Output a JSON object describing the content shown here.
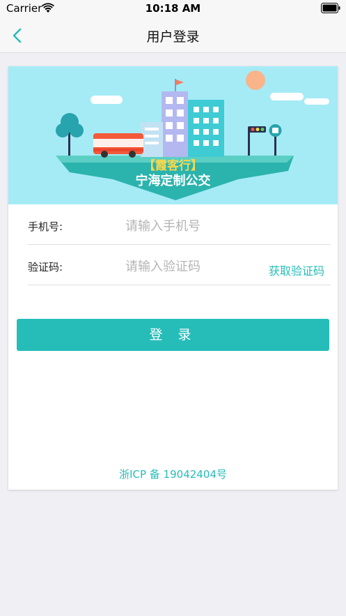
{
  "status_bar": {
    "carrier": "Carrier",
    "time": "10:18 AM"
  },
  "nav": {
    "title": "用户登录",
    "back_icon": "chevron-left-icon"
  },
  "banner": {
    "brand_name": "【霞客行】",
    "subtitle": "宁海定制公交"
  },
  "form": {
    "phone": {
      "label": "手机号:",
      "placeholder": "请输入手机号",
      "value": ""
    },
    "code": {
      "label": "验证码:",
      "placeholder": "请输入验证码",
      "value": "",
      "get_code_label": "获取验证码"
    },
    "login_label": "登 录"
  },
  "footer": {
    "icp": "浙ICP 备 19042404号"
  },
  "colors": {
    "accent": "#26bdb9",
    "banner_sky": "#a5ebf6",
    "brand_yellow": "#f8d84a"
  }
}
